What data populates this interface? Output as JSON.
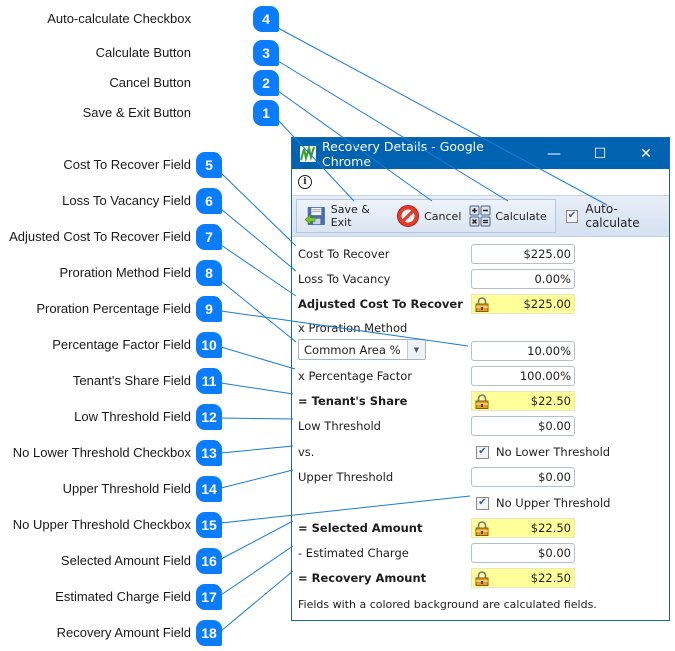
{
  "callouts": [
    {
      "number": "4",
      "label": "Auto-calculate Checkbox"
    },
    {
      "number": "3",
      "label": "Calculate Button"
    },
    {
      "number": "2",
      "label": "Cancel Button"
    },
    {
      "number": "1",
      "label": "Save & Exit Button"
    },
    {
      "number": "5",
      "label": "Cost To Recover Field"
    },
    {
      "number": "6",
      "label": "Loss To Vacancy Field"
    },
    {
      "number": "7",
      "label": "Adjusted Cost To Recover Field"
    },
    {
      "number": "8",
      "label": "Proration Method Field"
    },
    {
      "number": "9",
      "label": "Proration Percentage Field"
    },
    {
      "number": "10",
      "label": "Percentage Factor Field"
    },
    {
      "number": "11",
      "label": "Tenant's Share Field"
    },
    {
      "number": "12",
      "label": "Low Threshold Field"
    },
    {
      "number": "13",
      "label": "No Lower Threshold Checkbox"
    },
    {
      "number": "14",
      "label": "Upper Threshold Field"
    },
    {
      "number": "15",
      "label": "No Upper Threshold Checkbox"
    },
    {
      "number": "16",
      "label": "Selected Amount Field"
    },
    {
      "number": "17",
      "label": "Estimated Charge Field"
    },
    {
      "number": "18",
      "label": "Recovery Amount Field"
    }
  ],
  "window": {
    "title": "Recovery Details - Google Chrome",
    "controls": {
      "minimize": "—",
      "maximize": "☐",
      "close": "✕"
    },
    "info_icon": "i"
  },
  "toolbar": {
    "save_exit": "Save & Exit",
    "cancel": "Cancel",
    "calculate": "Calculate",
    "auto_calculate": {
      "label": "Auto-calculate",
      "checked": true
    }
  },
  "form": {
    "cost_to_recover": {
      "label": "Cost To Recover",
      "value": "$225.00"
    },
    "loss_to_vacancy": {
      "label": "Loss To Vacancy",
      "value": "0.00%"
    },
    "adjusted_cost": {
      "label": "Adjusted Cost To Recover",
      "value": "$225.00"
    },
    "proration_method": {
      "label": "x Proration Method",
      "selected": "Common Area %"
    },
    "proration_percentage": {
      "value": "10.00%"
    },
    "percentage_factor": {
      "label": "x Percentage Factor",
      "value": "100.00%"
    },
    "tenants_share": {
      "label": "= Tenant's Share",
      "value": "$22.50"
    },
    "low_threshold": {
      "label": "Low Threshold",
      "value": "$0.00"
    },
    "vs_label": "vs.",
    "no_lower_threshold": {
      "label": "No Lower Threshold",
      "checked": true
    },
    "upper_threshold": {
      "label": "Upper Threshold",
      "value": "$0.00"
    },
    "no_upper_threshold": {
      "label": "No Upper Threshold",
      "checked": true
    },
    "selected_amount": {
      "label": "= Selected Amount",
      "value": "$22.50"
    },
    "estimated_charge": {
      "label": "- Estimated Charge",
      "value": "$0.00"
    },
    "recovery_amount": {
      "label": "= Recovery Amount",
      "value": "$22.50"
    },
    "footnote": "Fields with a colored background are calculated fields."
  },
  "colors": {
    "titlebar": "#0063b1",
    "badge": "#0a7cff",
    "calculated_field": "#ffff99",
    "connector": "#1a7ad9"
  }
}
